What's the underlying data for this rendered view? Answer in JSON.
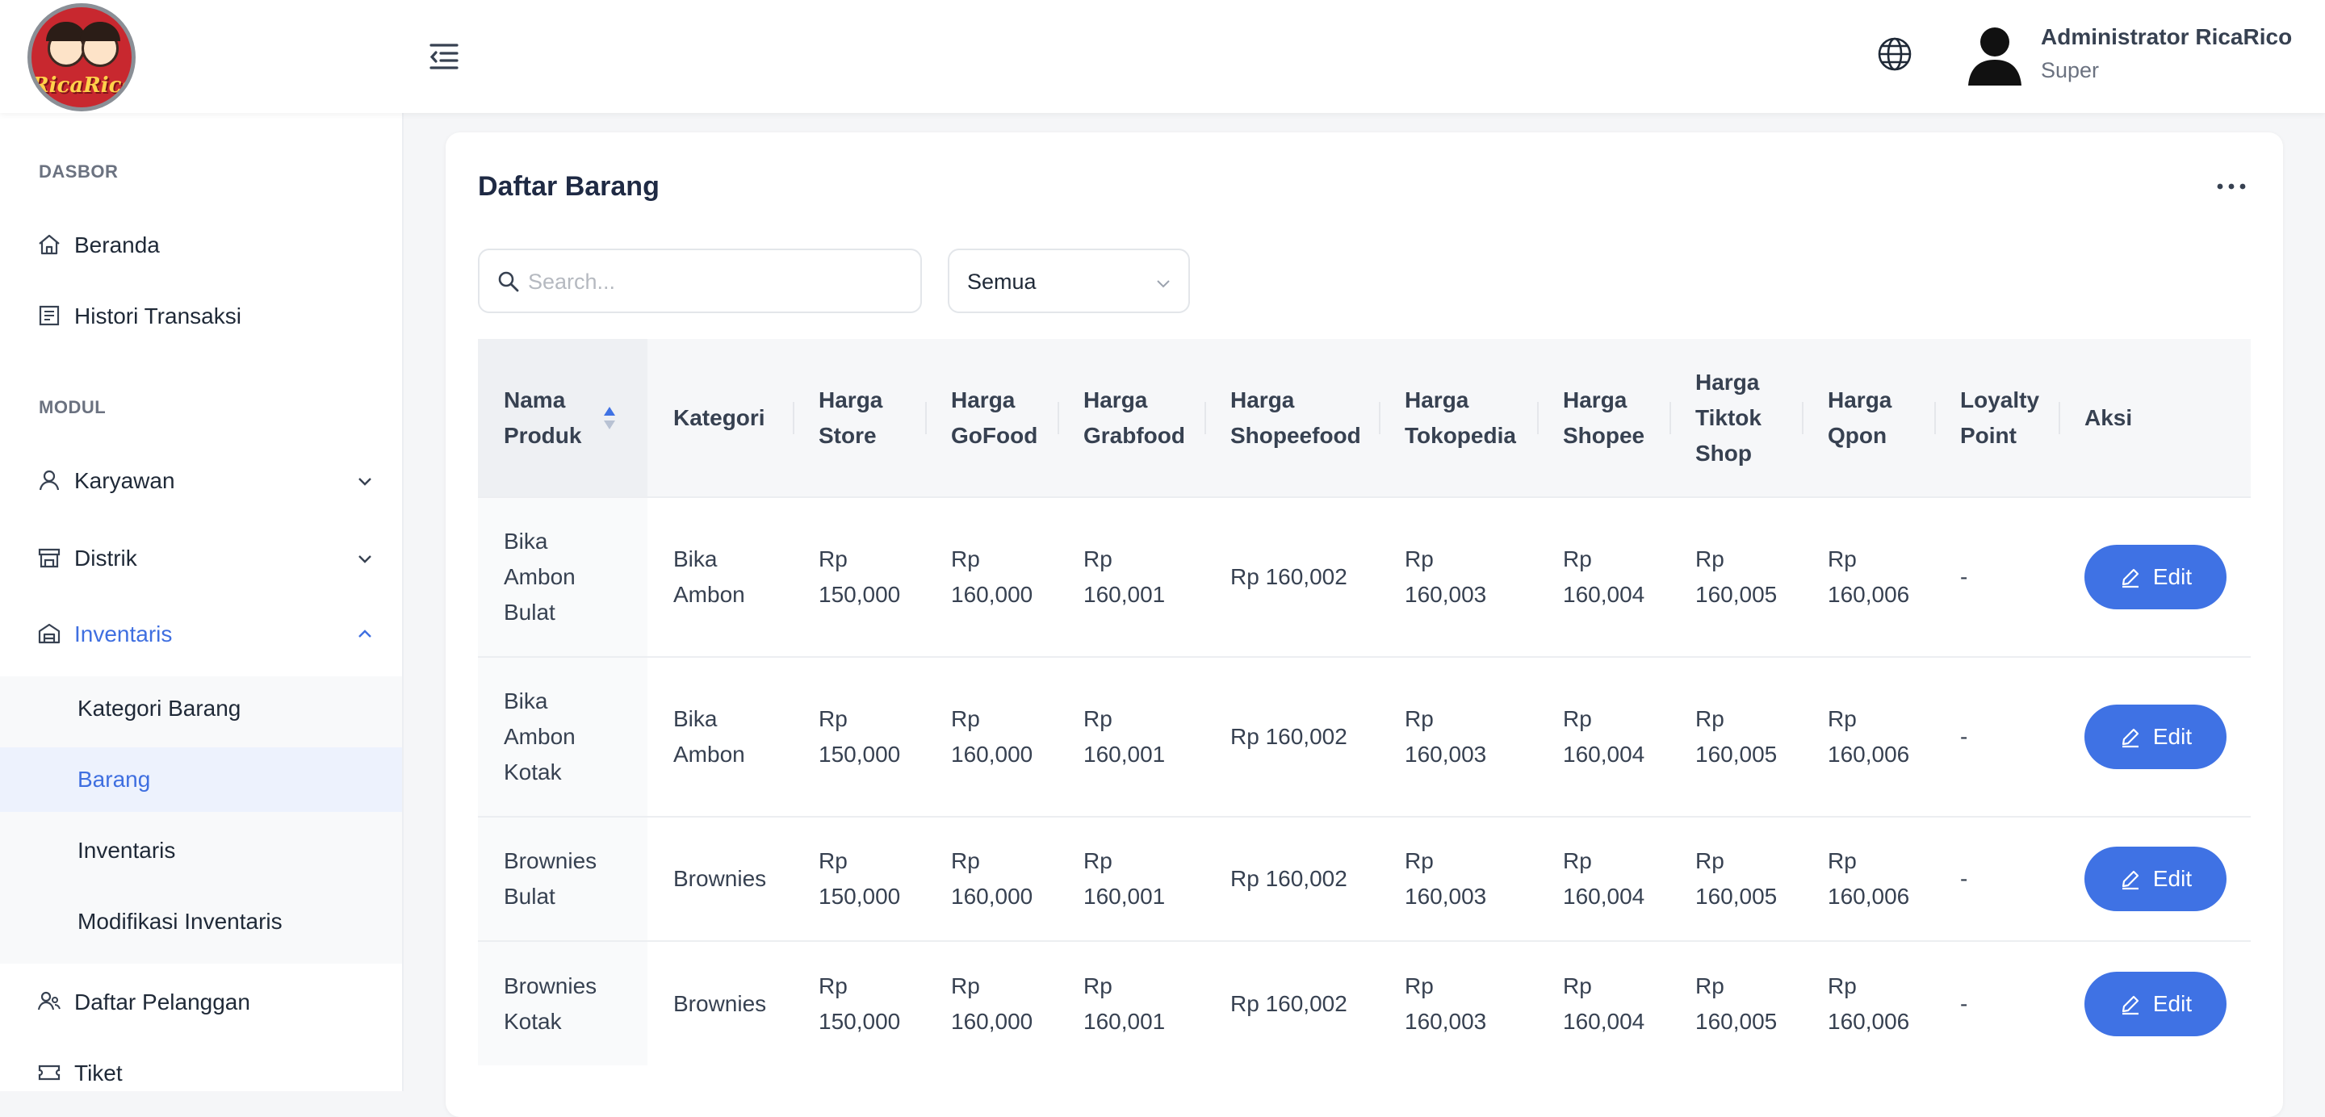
{
  "header": {
    "logo_text": "RicaRico",
    "user_name": "Administrator RicaRico",
    "user_role": "Super"
  },
  "sidebar": {
    "section_dasbor": "DASBOR",
    "section_modul": "MODUL",
    "items": {
      "beranda": "Beranda",
      "histori": "Histori Transaksi",
      "karyawan": "Karyawan",
      "distrik": "Distrik",
      "inventaris": "Inventaris",
      "pelanggan": "Daftar Pelanggan",
      "tiket": "Tiket"
    },
    "submenu": {
      "kategori": "Kategori Barang",
      "barang": "Barang",
      "inventaris": "Inventaris",
      "modifikasi": "Modifikasi Inventaris"
    }
  },
  "main": {
    "title": "Daftar Barang",
    "search_placeholder": "Search...",
    "filter_value": "Semua",
    "table": {
      "columns": [
        "Nama Produk",
        "Kategori",
        "Harga Store",
        "Harga GoFood",
        "Harga Grabfood",
        "Harga Shopeefood",
        "Harga Tokopedia",
        "Harga Shopee",
        "Harga Tiktok Shop",
        "Harga Qpon",
        "Loyalty Point",
        "Aksi"
      ],
      "edit_label": "Edit",
      "rows": [
        [
          "Bika Ambon Bulat",
          "Bika Ambon",
          "Rp 150,000",
          "Rp 160,000",
          "Rp 160,001",
          "Rp 160,002",
          "Rp 160,003",
          "Rp 160,004",
          "Rp 160,005",
          "Rp 160,006",
          "-"
        ],
        [
          "Bika Ambon Kotak",
          "Bika Ambon",
          "Rp 150,000",
          "Rp 160,000",
          "Rp 160,001",
          "Rp 160,002",
          "Rp 160,003",
          "Rp 160,004",
          "Rp 160,005",
          "Rp 160,006",
          "-"
        ],
        [
          "Brownies Bulat",
          "Brownies",
          "Rp 150,000",
          "Rp 160,000",
          "Rp 160,001",
          "Rp 160,002",
          "Rp 160,003",
          "Rp 160,004",
          "Rp 160,005",
          "Rp 160,006",
          "-"
        ],
        [
          "Brownies Kotak",
          "Brownies",
          "Rp 150,000",
          "Rp 160,000",
          "Rp 160,001",
          "Rp 160,002",
          "Rp 160,003",
          "Rp 160,004",
          "Rp 160,005",
          "Rp 160,006",
          "-"
        ]
      ]
    }
  },
  "colors": {
    "accent": "#3f72e4",
    "active_text": "#3f6fe0",
    "active_bg": "#edf2fd",
    "page_bg": "#f5f6f8"
  },
  "icons": [
    "menu-collapse-icon",
    "globe-icon",
    "user-avatar-icon",
    "home-icon",
    "receipt-icon",
    "user-icon",
    "store-icon",
    "warehouse-icon",
    "customers-icon",
    "ticket-icon",
    "search-icon",
    "chevron-down-icon",
    "chevron-up-icon",
    "sort-icon",
    "pencil-icon",
    "more-horizontal-icon"
  ]
}
